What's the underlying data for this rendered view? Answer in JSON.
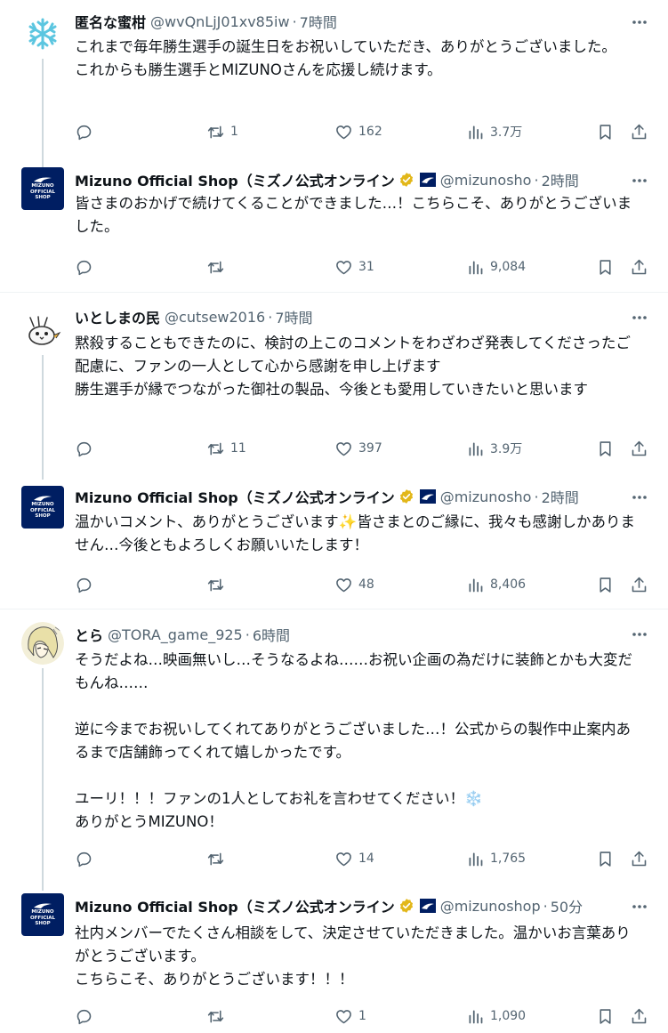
{
  "tweets": [
    {
      "name": "匿名な蜜柑",
      "handle": "@wvQnLjJ01xv85iw",
      "time": "7時間",
      "body": "これまで毎年勝生選手の誕生日をお祝いしていただき、ありがとうございました。\nこれからも勝生選手とMIZUNOさんを応援し続けます。",
      "replies": "",
      "retweets": "1",
      "likes": "162",
      "views": "3.7万",
      "avatar": "snowflake-avatar"
    },
    {
      "name": "Mizuno Official Shop（ミズノ公式オンライン",
      "handle": "@mizunosho",
      "time": "2時間",
      "body": "皆さまのおかげで続けてくることができました…！こちらこそ、ありがとうございました。",
      "replies": "",
      "retweets": "",
      "likes": "31",
      "views": "9,084",
      "avatar": "mizuno-logo"
    },
    {
      "name": "いとしまの民",
      "handle": "@cutsew2016",
      "time": "7時間",
      "body": "黙殺することもできたのに、検討の上このコメントをわざわざ発表してくださったご配慮に、ファンの一人として心から感謝を申し上げます\n勝生選手が縁でつながった御社の製品、今後とも愛用していきたいと思います",
      "replies": "",
      "retweets": "11",
      "likes": "397",
      "views": "3.9万",
      "avatar": "bird-avatar"
    },
    {
      "name": "Mizuno Official Shop（ミズノ公式オンライン",
      "handle": "@mizunosho",
      "time": "2時間",
      "body": "温かいコメント、ありがとうございます✨皆さまとのご縁に、我々も感謝しかありません…今後ともよろしくお願いいたします！",
      "replies": "",
      "retweets": "",
      "likes": "48",
      "views": "8,406",
      "avatar": "mizuno-logo"
    },
    {
      "name": "とら",
      "handle": "@TORA_game_925",
      "time": "6時間",
      "body": "そうだよね…映画無いし…そうなるよね……お祝い企画の為だけに装飾とかも大変だもんね……\n\n逆に今までお祝いしてくれてありがとうございました…！公式からの製作中止案内あるまで店舗飾ってくれて嬉しかったです。\n\nユーリ！！！ファンの1人としてお礼を言わせてください！❄️\nありがとうMIZUNO！",
      "replies": "",
      "retweets": "",
      "likes": "14",
      "views": "1,765",
      "avatar": "anime-avatar"
    },
    {
      "name": "Mizuno Official Shop（ミズノ公式オンライン",
      "handle": "@mizunoshop",
      "time": "50分",
      "body": "社内メンバーでたくさん相談をして、決定させていただきました。温かいお言葉ありがとうございます。\nこちらこそ、ありがとうございます！！！",
      "replies": "",
      "retweets": "",
      "likes": "1",
      "views": "1,090",
      "avatar": "mizuno-logo"
    }
  ],
  "mizuno_logo_text": [
    "MIZUNO",
    "OFFICIAL",
    "SHOP"
  ],
  "colors": {
    "text": "#0f1419",
    "secondary": "#536471",
    "thread_line": "#cfd9de",
    "verified_gold": "#e2b719",
    "mizuno_navy": "#001e62"
  }
}
